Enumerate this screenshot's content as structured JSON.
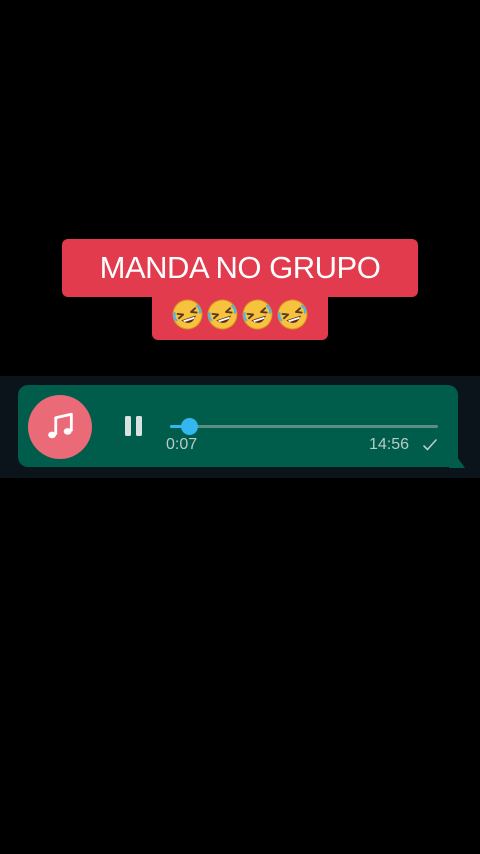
{
  "caption": {
    "line1": "MANDA NO GRUPO",
    "emojis": [
      "🤣",
      "🤣",
      "🤣",
      "🤣"
    ],
    "background_color": "#e23b4d"
  },
  "voice_message": {
    "avatar_icon": "music-note-icon",
    "play_state_icon": "pause-icon",
    "elapsed": "0:07",
    "progress_fraction": 0.07,
    "timestamp": "14:56",
    "status_icon": "single-check-icon",
    "bubble_color": "#005c4b",
    "accent_color": "#34b7f1",
    "avatar_color": "#ea6a78"
  }
}
